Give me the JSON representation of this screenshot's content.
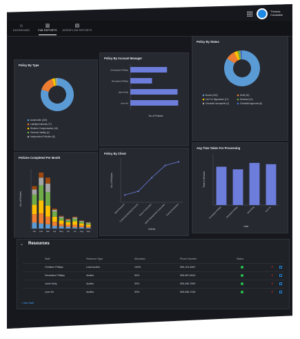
{
  "topbar": {
    "user_name": "Thomas Constable",
    "grid_icon": "apps-grid-icon",
    "avatar_icon": "user-avatar-icon"
  },
  "nav": {
    "items": [
      {
        "label": "DASHBOARD",
        "icon": "home-icon"
      },
      {
        "label": "FAB REPORTS",
        "icon": "chart-icon"
      },
      {
        "label": "WORKFLOW REPORTS",
        "icon": "table-icon"
      }
    ]
  },
  "cards": {
    "policy_by_type": "Policy By Type",
    "policy_by_manager": "Policy By Account Manager",
    "policy_by_status": "Policy By Status",
    "policies_by_month": "Policies Completed Per Month",
    "policy_by_client": "Policy By Client",
    "avg_time": "Avg Time Taken For Processing"
  },
  "chart_data": [
    {
      "type": "pie",
      "title": "Policy By Type",
      "labels": [
        "Automobile (420)",
        "Liability/Umbrella (77)",
        "Workers Compensation (16)",
        "General Liability (4)",
        "Independent Pollution (8)"
      ],
      "values": [
        420,
        77,
        16,
        4,
        8
      ],
      "colors": [
        "#5b9bd5",
        "#ed7d31",
        "#ffc000",
        "#70ad47",
        "#a5a5a5"
      ]
    },
    {
      "type": "bar",
      "title": "Policy By Account Manager",
      "categories": [
        "Christopher Phillips",
        "Demesthe Phillips",
        "Janet Kelly",
        "Lynn Hu"
      ],
      "values": [
        115,
        68,
        148,
        150
      ],
      "xlabel": "No of Policies",
      "xlim": [
        0,
        160
      ],
      "color": "#6c7ddb"
    },
    {
      "type": "pie",
      "title": "Policy By Status",
      "labels": [
        "Bound (430)",
        "Draft (42)",
        "Out For Signatures (17)",
        "Declined (11)",
        "Checklist Incomplete (2)",
        "Checklist Approved (8)"
      ],
      "values": [
        430,
        42,
        17,
        11,
        2,
        8
      ],
      "colors": [
        "#5b9bd5",
        "#ed7d31",
        "#ffc000",
        "#70ad47",
        "#a5a5a5",
        "#4472c4"
      ]
    },
    {
      "type": "bar",
      "title": "Policies Completed Per Month",
      "categories": [
        "Jan",
        "Feb",
        "Mar",
        "Apr",
        "May",
        "Jun",
        "Jul",
        "Aug",
        "Sep"
      ],
      "ylabel": "No. of Policies",
      "ylim": [
        0,
        140
      ],
      "series": [
        {
          "color": "#5b9bd5",
          "values": [
            14,
            12,
            10,
            6,
            5,
            4,
            3,
            3,
            2
          ]
        },
        {
          "color": "#ed7d31",
          "values": [
            20,
            24,
            18,
            10,
            6,
            5,
            6,
            4,
            3
          ]
        },
        {
          "color": "#ffc000",
          "values": [
            22,
            30,
            26,
            12,
            8,
            6,
            8,
            5,
            4
          ]
        },
        {
          "color": "#70ad47",
          "values": [
            24,
            36,
            32,
            12,
            6,
            4,
            6,
            4,
            3
          ]
        },
        {
          "color": "#a5a5a5",
          "values": [
            12,
            18,
            20,
            4,
            3,
            2,
            3,
            2,
            2
          ]
        },
        {
          "color": "#9e480e",
          "values": [
            8,
            12,
            14,
            3,
            2,
            2,
            2,
            1,
            1
          ]
        }
      ]
    },
    {
      "type": "line",
      "title": "Policy By Client",
      "categories": [
        "Baird Research",
        "Continental Building Products",
        "Harsco Corporation",
        "Apollo Management Corporation",
        "Harvey Enterprises"
      ],
      "values": [
        30,
        45,
        100,
        150,
        165
      ],
      "xlabel": "Clients",
      "ylabel": "No. of Policies",
      "ylim": [
        0,
        180
      ],
      "color": "#6c7ddb"
    },
    {
      "type": "bar",
      "title": "Avg Time Taken For Processing",
      "categories": [
        "Christopher Phillips",
        "Demesthe Phillips",
        "Janet Kelly",
        "Lynn Hu"
      ],
      "values": [
        120,
        112,
        132,
        128
      ],
      "xlabel": "User",
      "ylabel": "Time in Minutes",
      "ylim": [
        0,
        160
      ],
      "color": "#6c7ddb"
    }
  ],
  "resources": {
    "title": "Resources",
    "headers": [
      "Staff",
      "Resource Type",
      "Allocation",
      "Phone Number",
      "Status"
    ],
    "rows": [
      [
        "Christine Phillips",
        "Lead Auditor",
        "100%",
        "555-123-4567",
        "active"
      ],
      [
        "Demesthe Phillips",
        "Auditor",
        "50%",
        "555-987-6543",
        "active"
      ],
      [
        "Janet Kelly",
        "Auditor",
        "50%",
        "555-456-7890",
        "active"
      ],
      [
        "Lynn Hu",
        "Auditor",
        "50%",
        "555-086-7436",
        "active"
      ]
    ],
    "add_label": "+ Add Staff"
  }
}
